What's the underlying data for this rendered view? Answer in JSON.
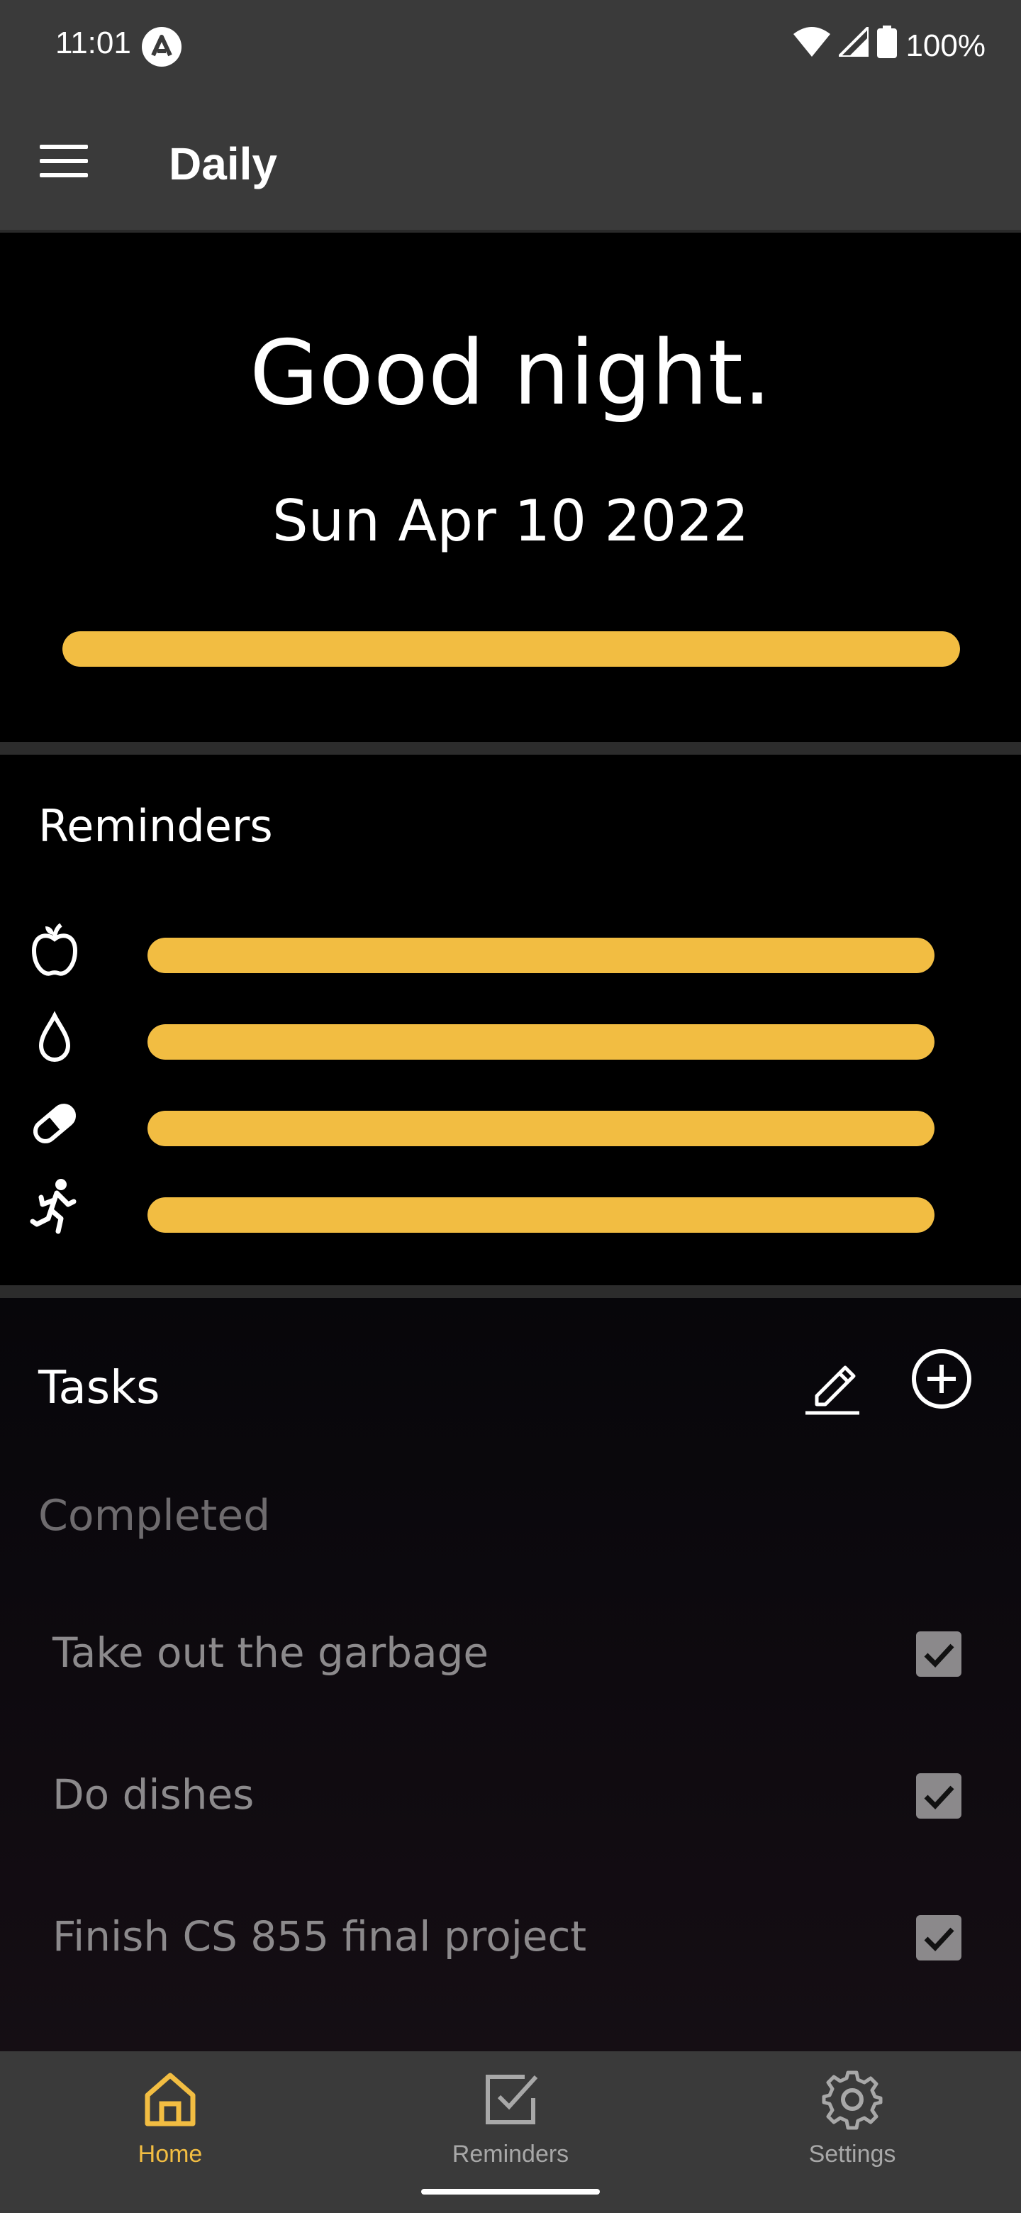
{
  "status_bar": {
    "time": "11:01",
    "battery": "100%",
    "icons": [
      "app-notification-icon",
      "wifi-icon",
      "signal-icon",
      "battery-icon"
    ]
  },
  "app_bar": {
    "title": "Daily",
    "menu_icon": "menu-icon"
  },
  "greeting": {
    "text": "Good night.",
    "date": "Sun Apr 10 2022",
    "day_progress": 1.0
  },
  "reminders": {
    "title": "Reminders",
    "items": [
      {
        "icon": "apple-icon",
        "progress": 1.0
      },
      {
        "icon": "water-drop-icon",
        "progress": 1.0
      },
      {
        "icon": "pill-icon",
        "progress": 1.0
      },
      {
        "icon": "running-icon",
        "progress": 1.0
      }
    ]
  },
  "tasks": {
    "title": "Tasks",
    "edit_icon": "pencil-icon",
    "add_icon": "plus-circle-icon",
    "completed_label": "Completed",
    "items": [
      {
        "label": "Take out the garbage",
        "checked": true
      },
      {
        "label": "Do dishes",
        "checked": true
      },
      {
        "label": "Finish CS 855 final project",
        "checked": true
      }
    ]
  },
  "bottom_nav": {
    "items": [
      {
        "label": "Home",
        "icon": "home-icon",
        "active": true
      },
      {
        "label": "Reminders",
        "icon": "checkbox-icon",
        "active": false
      },
      {
        "label": "Settings",
        "icon": "gear-icon",
        "active": false
      }
    ]
  },
  "colors": {
    "accent": "#f2bd42",
    "bar_background": "#3a3a3a",
    "background": "#000000"
  }
}
